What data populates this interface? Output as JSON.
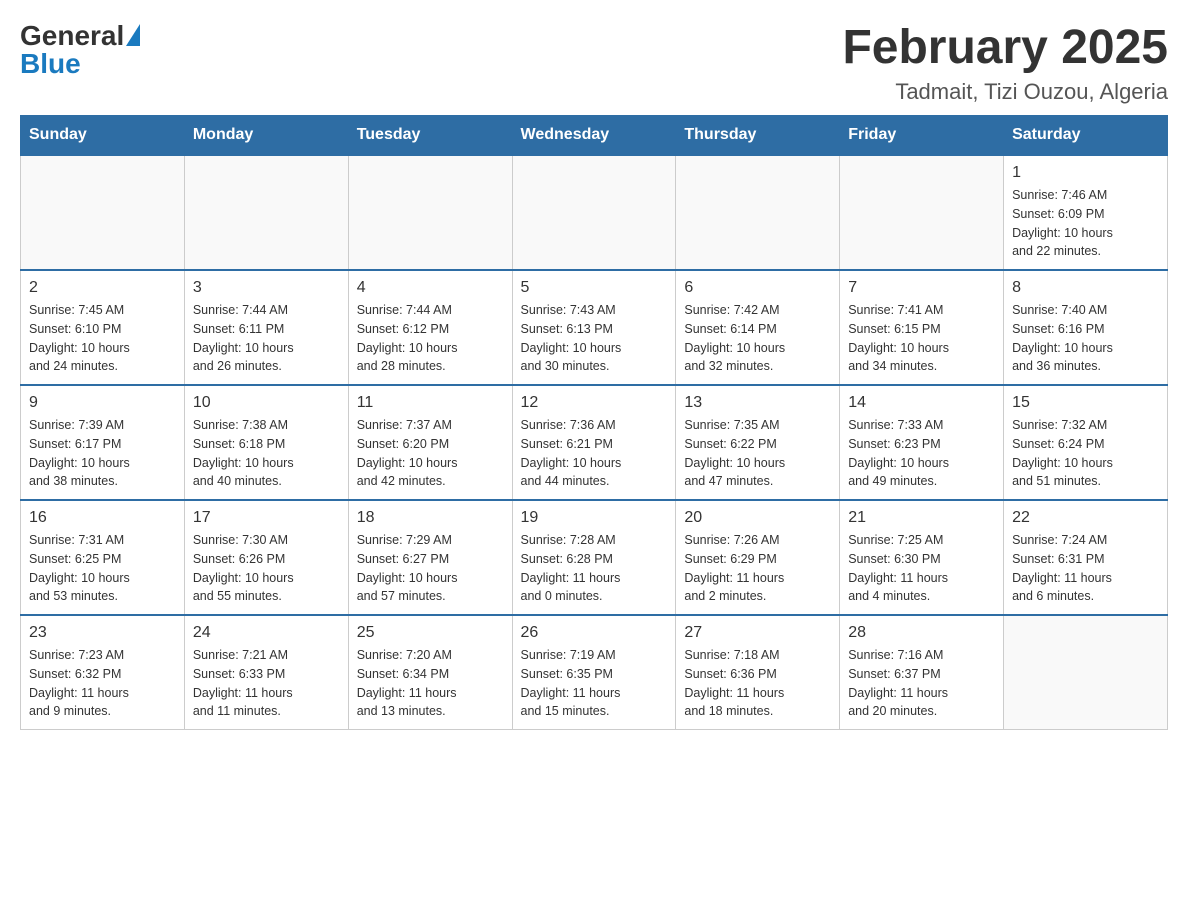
{
  "header": {
    "logo_general": "General",
    "logo_blue": "Blue",
    "month_title": "February 2025",
    "location": "Tadmait, Tizi Ouzou, Algeria"
  },
  "weekdays": [
    "Sunday",
    "Monday",
    "Tuesday",
    "Wednesday",
    "Thursday",
    "Friday",
    "Saturday"
  ],
  "weeks": [
    [
      {
        "day": "",
        "info": ""
      },
      {
        "day": "",
        "info": ""
      },
      {
        "day": "",
        "info": ""
      },
      {
        "day": "",
        "info": ""
      },
      {
        "day": "",
        "info": ""
      },
      {
        "day": "",
        "info": ""
      },
      {
        "day": "1",
        "info": "Sunrise: 7:46 AM\nSunset: 6:09 PM\nDaylight: 10 hours\nand 22 minutes."
      }
    ],
    [
      {
        "day": "2",
        "info": "Sunrise: 7:45 AM\nSunset: 6:10 PM\nDaylight: 10 hours\nand 24 minutes."
      },
      {
        "day": "3",
        "info": "Sunrise: 7:44 AM\nSunset: 6:11 PM\nDaylight: 10 hours\nand 26 minutes."
      },
      {
        "day": "4",
        "info": "Sunrise: 7:44 AM\nSunset: 6:12 PM\nDaylight: 10 hours\nand 28 minutes."
      },
      {
        "day": "5",
        "info": "Sunrise: 7:43 AM\nSunset: 6:13 PM\nDaylight: 10 hours\nand 30 minutes."
      },
      {
        "day": "6",
        "info": "Sunrise: 7:42 AM\nSunset: 6:14 PM\nDaylight: 10 hours\nand 32 minutes."
      },
      {
        "day": "7",
        "info": "Sunrise: 7:41 AM\nSunset: 6:15 PM\nDaylight: 10 hours\nand 34 minutes."
      },
      {
        "day": "8",
        "info": "Sunrise: 7:40 AM\nSunset: 6:16 PM\nDaylight: 10 hours\nand 36 minutes."
      }
    ],
    [
      {
        "day": "9",
        "info": "Sunrise: 7:39 AM\nSunset: 6:17 PM\nDaylight: 10 hours\nand 38 minutes."
      },
      {
        "day": "10",
        "info": "Sunrise: 7:38 AM\nSunset: 6:18 PM\nDaylight: 10 hours\nand 40 minutes."
      },
      {
        "day": "11",
        "info": "Sunrise: 7:37 AM\nSunset: 6:20 PM\nDaylight: 10 hours\nand 42 minutes."
      },
      {
        "day": "12",
        "info": "Sunrise: 7:36 AM\nSunset: 6:21 PM\nDaylight: 10 hours\nand 44 minutes."
      },
      {
        "day": "13",
        "info": "Sunrise: 7:35 AM\nSunset: 6:22 PM\nDaylight: 10 hours\nand 47 minutes."
      },
      {
        "day": "14",
        "info": "Sunrise: 7:33 AM\nSunset: 6:23 PM\nDaylight: 10 hours\nand 49 minutes."
      },
      {
        "day": "15",
        "info": "Sunrise: 7:32 AM\nSunset: 6:24 PM\nDaylight: 10 hours\nand 51 minutes."
      }
    ],
    [
      {
        "day": "16",
        "info": "Sunrise: 7:31 AM\nSunset: 6:25 PM\nDaylight: 10 hours\nand 53 minutes."
      },
      {
        "day": "17",
        "info": "Sunrise: 7:30 AM\nSunset: 6:26 PM\nDaylight: 10 hours\nand 55 minutes."
      },
      {
        "day": "18",
        "info": "Sunrise: 7:29 AM\nSunset: 6:27 PM\nDaylight: 10 hours\nand 57 minutes."
      },
      {
        "day": "19",
        "info": "Sunrise: 7:28 AM\nSunset: 6:28 PM\nDaylight: 11 hours\nand 0 minutes."
      },
      {
        "day": "20",
        "info": "Sunrise: 7:26 AM\nSunset: 6:29 PM\nDaylight: 11 hours\nand 2 minutes."
      },
      {
        "day": "21",
        "info": "Sunrise: 7:25 AM\nSunset: 6:30 PM\nDaylight: 11 hours\nand 4 minutes."
      },
      {
        "day": "22",
        "info": "Sunrise: 7:24 AM\nSunset: 6:31 PM\nDaylight: 11 hours\nand 6 minutes."
      }
    ],
    [
      {
        "day": "23",
        "info": "Sunrise: 7:23 AM\nSunset: 6:32 PM\nDaylight: 11 hours\nand 9 minutes."
      },
      {
        "day": "24",
        "info": "Sunrise: 7:21 AM\nSunset: 6:33 PM\nDaylight: 11 hours\nand 11 minutes."
      },
      {
        "day": "25",
        "info": "Sunrise: 7:20 AM\nSunset: 6:34 PM\nDaylight: 11 hours\nand 13 minutes."
      },
      {
        "day": "26",
        "info": "Sunrise: 7:19 AM\nSunset: 6:35 PM\nDaylight: 11 hours\nand 15 minutes."
      },
      {
        "day": "27",
        "info": "Sunrise: 7:18 AM\nSunset: 6:36 PM\nDaylight: 11 hours\nand 18 minutes."
      },
      {
        "day": "28",
        "info": "Sunrise: 7:16 AM\nSunset: 6:37 PM\nDaylight: 11 hours\nand 20 minutes."
      },
      {
        "day": "",
        "info": ""
      }
    ]
  ]
}
